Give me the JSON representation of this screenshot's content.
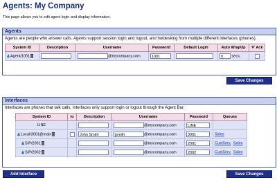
{
  "page": {
    "title": "Agents: My Company",
    "description": "This page allows you to edit agent login and display information."
  },
  "agents": {
    "header": "Agents",
    "description": "Agents are people who answer calls. Agents support session login and logout, and hotdesking from multiple different interfaces (phones).",
    "columns": [
      "System ID",
      "Description",
      "Username",
      "Password",
      "Default Login",
      "Auto WrapUp",
      "'#' Ack"
    ],
    "rows": [
      {
        "system_id": "Agent/1001",
        "description": "",
        "username": "",
        "domain": "@mycompany.com",
        "password": "1001",
        "default_login": "",
        "wrapup": "0",
        "wrapup_unit": "secs."
      }
    ],
    "save_label": "Save Changes"
  },
  "interfaces": {
    "header": "Interfaces",
    "description": "Interfaces are phones that talk calls. Interfaces only support login or logout through the Agent Bar.",
    "columns": [
      "System ID",
      "/o",
      "Description",
      "Username",
      "Password",
      "Queues"
    ],
    "rows": [
      {
        "system_id": "LINE",
        "description": "",
        "username": "",
        "domain": "@mycompany.com",
        "password": "LINE",
        "queues": []
      },
      {
        "system_id": "Local/3001@main",
        "description": "John Smith",
        "username": "jsmith",
        "domain": "@mycompany.com",
        "password": "3001",
        "queues": [
          "Sales"
        ]
      },
      {
        "system_id": "SIP/2001",
        "description": "",
        "username": "",
        "domain": "@mycompany.com",
        "password": "2001",
        "queues": [
          "CustServ,",
          "Sales"
        ]
      },
      {
        "system_id": "SIP/2002",
        "description": "",
        "username": "",
        "domain": "@mycompany.com",
        "password": "2002",
        "queues": [
          "CustServ,",
          "Sales"
        ]
      }
    ],
    "add_label": "Add Interface",
    "save_label": "Save Changes"
  }
}
